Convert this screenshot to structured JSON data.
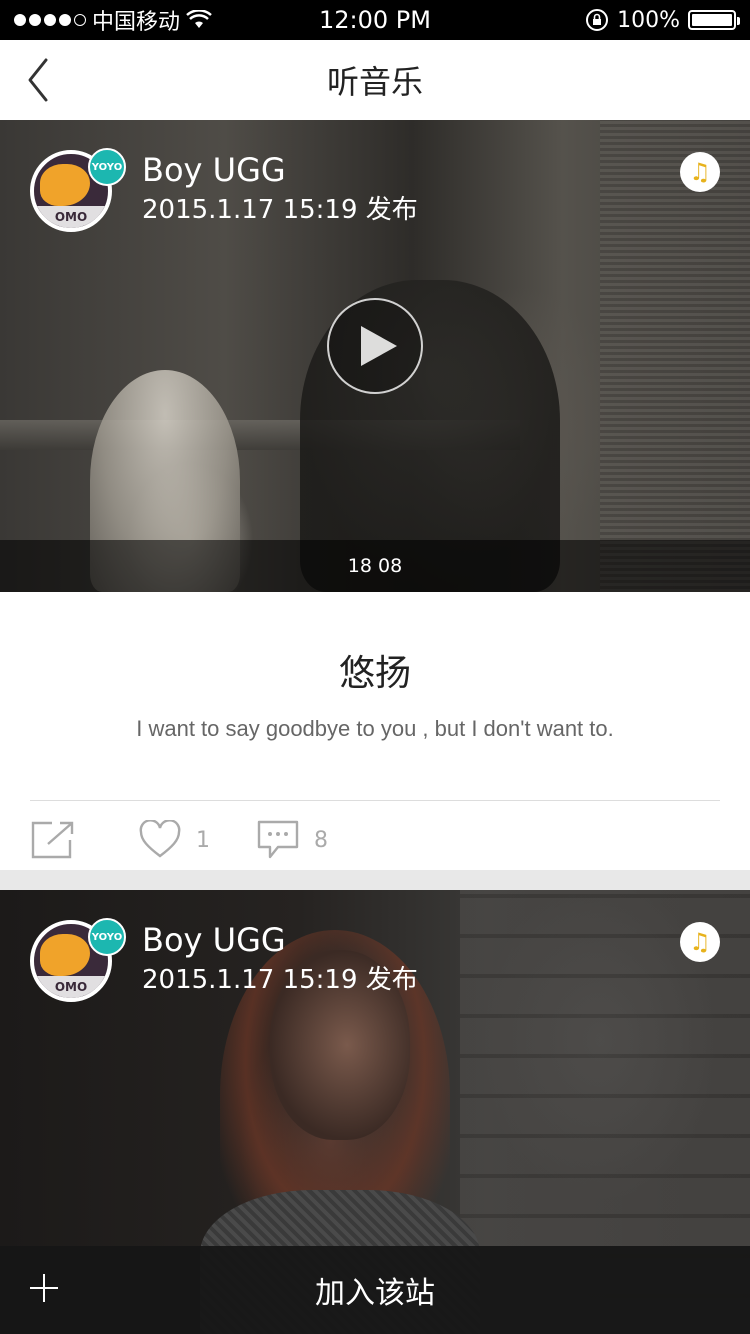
{
  "status_bar": {
    "carrier": "中国移动",
    "time": "12:00 PM",
    "battery_text": "100%",
    "battery_level": 1.0
  },
  "nav": {
    "title": "听音乐",
    "back_icon": "chevron-left-icon"
  },
  "posts": [
    {
      "author": "Boy UGG",
      "date": "2015.1.17 15:19  发布",
      "avatar_badge": "YOYO",
      "avatar_rim_text": "OMO",
      "media_time": "18 08",
      "title": "悠扬",
      "description": "I want to say goodbye to you , but I don't want to.",
      "likes": "1",
      "comments": "8",
      "music_icon": "♫"
    },
    {
      "author": "Boy UGG",
      "date": "2015.1.17 15:19  发布",
      "avatar_badge": "YOYO",
      "avatar_rim_text": "OMO",
      "music_icon": "♫"
    }
  ],
  "bottom_bar": {
    "label": "加入该站",
    "icon": "plus-icon"
  },
  "colors": {
    "accent_music": "#e7b21c",
    "badge": "#1cb7b0",
    "avatar_lemon": "#f0a32a"
  }
}
